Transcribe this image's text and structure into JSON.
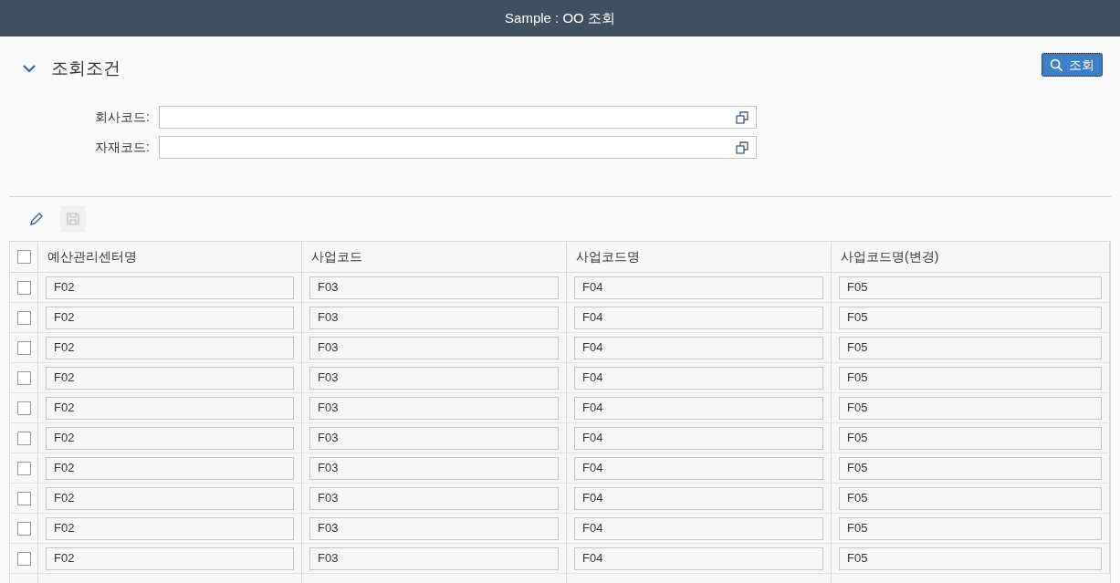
{
  "window": {
    "title": "Sample : OO 조회"
  },
  "filter_panel": {
    "title": "조회조건",
    "expanded": true,
    "search_button": "조회",
    "fields": [
      {
        "label": "회사코드:"
      },
      {
        "label": "자재코드:"
      }
    ]
  },
  "toolbar": [
    {
      "kind": "edit",
      "disabled": false
    },
    {
      "kind": "save",
      "disabled": true
    }
  ],
  "table": {
    "select_all": false,
    "columns": [
      "예산관리센터명",
      "사업코드",
      "사업코드명",
      "사업코드명(변경)"
    ],
    "rows": [
      {
        "selected": false,
        "cells": [
          "F02",
          "F03",
          "F04",
          "F05"
        ]
      },
      {
        "selected": false,
        "cells": [
          "F02",
          "F03",
          "F04",
          "F05"
        ]
      },
      {
        "selected": false,
        "cells": [
          "F02",
          "F03",
          "F04",
          "F05"
        ]
      },
      {
        "selected": false,
        "cells": [
          "F02",
          "F03",
          "F04",
          "F05"
        ]
      },
      {
        "selected": false,
        "cells": [
          "F02",
          "F03",
          "F04",
          "F05"
        ]
      },
      {
        "selected": false,
        "cells": [
          "F02",
          "F03",
          "F04",
          "F05"
        ]
      },
      {
        "selected": false,
        "cells": [
          "F02",
          "F03",
          "F04",
          "F05"
        ]
      },
      {
        "selected": false,
        "cells": [
          "F02",
          "F03",
          "F04",
          "F05"
        ]
      },
      {
        "selected": false,
        "cells": [
          "F02",
          "F03",
          "F04",
          "F05"
        ]
      },
      {
        "selected": false,
        "cells": [
          "F02",
          "F03",
          "F04",
          "F05"
        ]
      }
    ]
  }
}
